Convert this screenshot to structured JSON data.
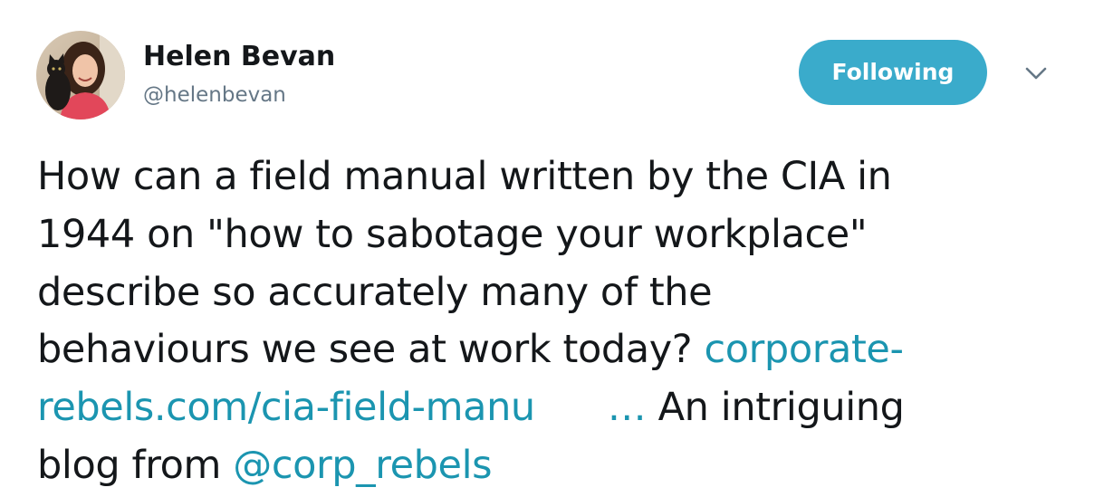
{
  "user": {
    "name": "Helen Bevan",
    "handle": "@helenbevan"
  },
  "follow_button": {
    "label": "Following"
  },
  "tweet": {
    "line1": "How can a field manual written by the CIA in",
    "line2": "1944 on \"how to sabotage your workplace\"",
    "line3": "describe so accurately many of the",
    "line4_text": "behaviours we see at work today? ",
    "link_part1": "corporate-",
    "link_part2": "rebels.com/cia-field-manu",
    "ellipsis": "…",
    "line5_text": " An intriguing",
    "line6_text": "blog from ",
    "mention": "@corp_rebels"
  },
  "colors": {
    "follow_button_bg": "#3aabcb",
    "link": "#1b95b0",
    "handle": "#657786",
    "text": "#14171a"
  },
  "icons": {
    "caret": "chevron-down-icon"
  }
}
